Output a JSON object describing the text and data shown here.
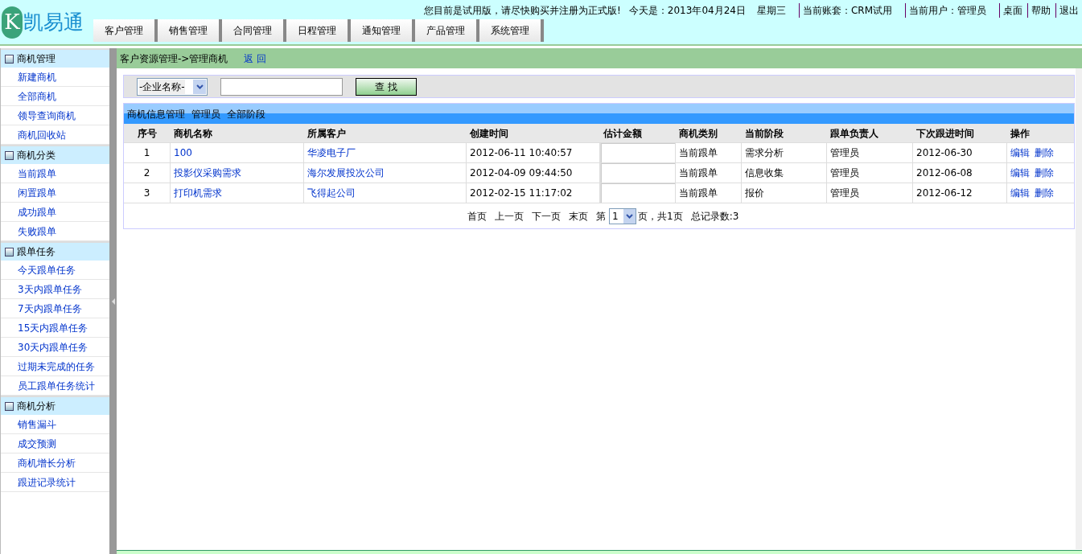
{
  "header": {
    "logo_letter": "K",
    "logo_text": "凯易通",
    "notice": "您目前是试用版，请尽快购买并注册为正式版!",
    "today": "今天是：2013年04月24日",
    "weekday": "星期三",
    "info": [
      {
        "text": "当前账套：CRM试用",
        "kind": "info"
      },
      {
        "text": "当前用户：管理员",
        "kind": "info"
      },
      {
        "text": "桌面",
        "kind": "link"
      },
      {
        "text": "帮助",
        "kind": "link"
      },
      {
        "text": "退出",
        "kind": "link"
      }
    ],
    "tabs": [
      "客户管理",
      "销售管理",
      "合同管理",
      "日程管理",
      "通知管理",
      "产品管理",
      "系统管理"
    ]
  },
  "sidebar": [
    {
      "title": "商机管理",
      "items": [
        "新建商机",
        "全部商机",
        "领导查询商机",
        "商机回收站"
      ]
    },
    {
      "title": "商机分类",
      "items": [
        "当前跟单",
        "闲置跟单",
        "成功跟单",
        "失败跟单"
      ]
    },
    {
      "title": "跟单任务",
      "items": [
        "今天跟单任务",
        "3天内跟单任务",
        "7天内跟单任务",
        "15天内跟单任务",
        "30天内跟单任务",
        "过期未完成的任务",
        "员工跟单任务统计"
      ]
    },
    {
      "title": "商机分析",
      "items": [
        "销售漏斗",
        "成交预测",
        "商机增长分析",
        "跟进记录统计"
      ]
    }
  ],
  "breadcrumb": "客户资源管理->管理商机",
  "back_link": "返 回",
  "search": {
    "select": "-企业名称-",
    "button": "查 找"
  },
  "table": {
    "caption": [
      "商机信息管理",
      "管理员",
      "全部阶段"
    ],
    "columns": [
      "序号",
      "商机名称",
      "所属客户",
      "创建时间",
      "估计金额",
      "商机类别",
      "当前阶段",
      "跟单负责人",
      "下次跟进时间",
      "操作"
    ],
    "rows": [
      [
        "1",
        "100",
        "华凌电子厂",
        "2012-06-11 10:40:57",
        "",
        "当前跟单",
        "需求分析",
        "管理员",
        "2012-06-30",
        [
          "编辑",
          "删除"
        ]
      ],
      [
        "2",
        "投影仪采购需求",
        "海尔发展投次公司",
        "2012-04-09 09:44:50",
        "",
        "当前跟单",
        "信息收集",
        "管理员",
        "2012-06-08",
        [
          "编辑",
          "删除"
        ]
      ],
      [
        "3",
        "打印机需求",
        "飞得起公司",
        "2012-02-15 11:17:02",
        "",
        "当前跟单",
        "报价",
        "管理员",
        "2012-06-12",
        [
          "编辑",
          "删除"
        ]
      ]
    ]
  },
  "pager": {
    "links": [
      "首页",
      "上一页",
      "下一页",
      "末页"
    ],
    "before": "第",
    "page": "1",
    "after": "页，共1页",
    "total": "总记录数:3"
  }
}
